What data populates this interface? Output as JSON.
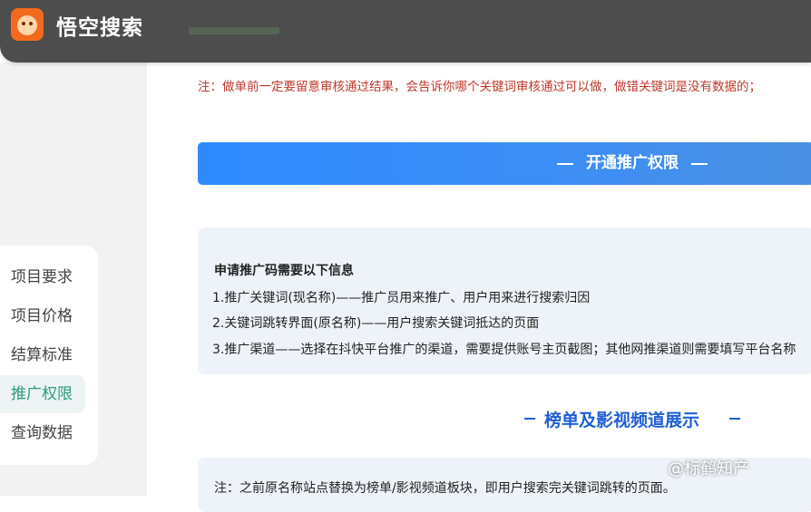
{
  "header": {
    "brand": "悟空搜索",
    "logo_icon": "monkey-logo-icon",
    "colors": {
      "bar": "#4d4d4d",
      "logo": "#f36a1f"
    }
  },
  "sidebar": {
    "items": [
      {
        "label": "项目要求",
        "active": false
      },
      {
        "label": "项目价格",
        "active": false
      },
      {
        "label": "结算标准",
        "active": false
      },
      {
        "label": "推广权限",
        "active": true
      },
      {
        "label": "查询数据",
        "active": false
      }
    ],
    "active_color": "#2b9c7f"
  },
  "main": {
    "notice": "注：做单前一定要留意审核通过结果，会告诉你哪个关键词审核通过可以做，做错关键词是没有数据的；",
    "banner": {
      "title": "开通推广权限",
      "color": "#2f8bff"
    },
    "info": {
      "heading": "申请推广码需要以下信息",
      "lines": [
        "1.推广关键词(现名称)——推广员用来推广、用户用来进行搜索归因",
        "2.关键词跳转界面(原名称)——用户搜索关键词抵达的页面",
        "3.推广渠道——选择在抖快平台推广的渠道，需要提供账号主页截图；其他网推渠道则需要填写平台名称"
      ]
    },
    "section": {
      "title": "榜单及影视频道展示",
      "color": "#1f5fd6"
    },
    "bottom_note": "注：之前原名称站点替换为榜单/影视频道板块，即用户搜索完关键词跳转的页面。"
  },
  "watermark": "@标鹤知产"
}
